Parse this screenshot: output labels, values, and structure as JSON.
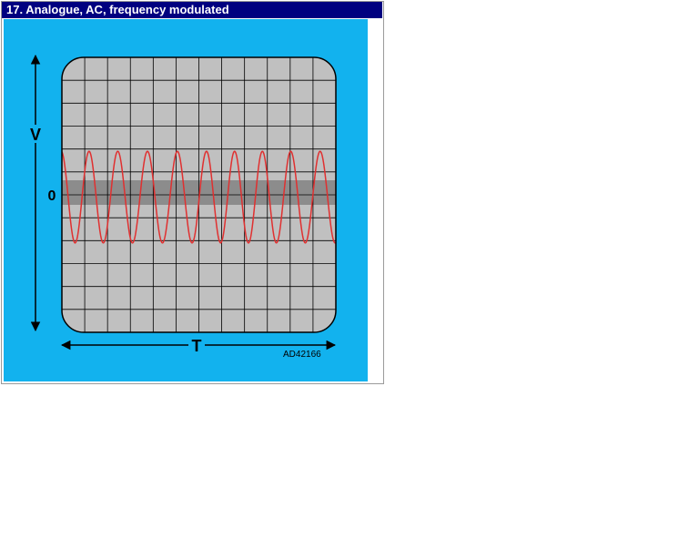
{
  "title": "17. Analogue, AC, frequency modulated",
  "labels": {
    "voltage_axis": "V",
    "zero_level": "0",
    "time_axis": "T",
    "figure_code": "AD42166"
  },
  "colors": {
    "title_bar": "#000080",
    "figure_background": "#12b2ee",
    "screen": "#c0c0c0",
    "zero_band": "#8c8c8c",
    "grid": "#000000",
    "signal": "#e03030"
  },
  "screen_grid": {
    "columns": 12,
    "rows": 12
  },
  "signal": {
    "type": "sine",
    "modulation": "frequency",
    "cycles": 9.5
  }
}
